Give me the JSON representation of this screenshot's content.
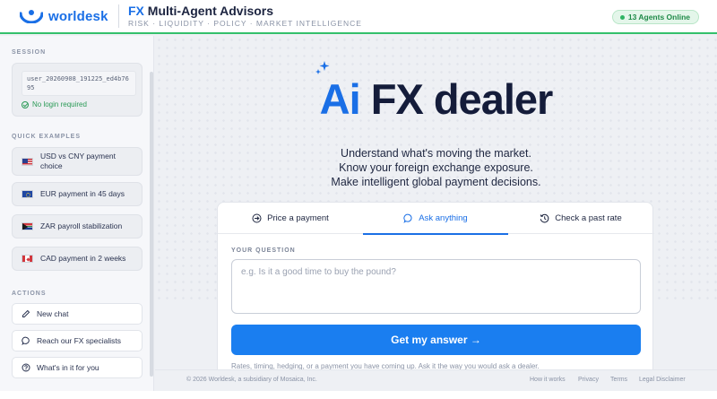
{
  "header": {
    "logo_text": "worldesk",
    "brand_fx": "FX",
    "brand_rest": " Multi-Agent Advisors",
    "subtitle": "RISK · LIQUIDITY · POLICY · MARKET INTELLIGENCE",
    "agents_badge": "13 Agents Online"
  },
  "sidebar": {
    "session_label": "SESSION",
    "session_id": "user_20260908_191225_ed4b7695",
    "no_login": "No login required",
    "examples_label": "QUICK EXAMPLES",
    "examples": [
      {
        "label": "USD vs CNY payment choice",
        "flag": "us-flag-icon"
      },
      {
        "label": "EUR payment in 45 days",
        "flag": "eu-flag-icon"
      },
      {
        "label": "ZAR payroll stabilization",
        "flag": "za-flag-icon"
      },
      {
        "label": "CAD payment in 2 weeks",
        "flag": "ca-flag-icon"
      }
    ],
    "actions_label": "ACTIONS",
    "actions": [
      {
        "label": "New chat",
        "icon": "edit-icon"
      },
      {
        "label": "Reach our FX specialists",
        "icon": "chat-bubble-icon"
      },
      {
        "label": "What's in it for you",
        "icon": "help-icon"
      }
    ]
  },
  "hero": {
    "title_ai": "Ai",
    "title_rest": " FX dealer",
    "line1": "Understand what's moving the market.",
    "line2": "Know your foreign exchange exposure.",
    "line3": "Make intelligent global payment decisions."
  },
  "tabs": [
    {
      "label": "Price a payment",
      "icon": "arrow-circle-icon",
      "active": false
    },
    {
      "label": "Ask anything",
      "icon": "chat-bubble-icon",
      "active": true
    },
    {
      "label": "Check a past rate",
      "icon": "history-icon",
      "active": false
    }
  ],
  "question": {
    "label": "YOUR QUESTION",
    "placeholder": "e.g. Is it a good time to buy the pound?",
    "value": "",
    "submit_label": "Get my answer →",
    "hint": "Rates, timing, hedging, or a payment you have coming up. Ask it the way you would ask a dealer."
  },
  "footer": {
    "copyright": "© 2026 Worldesk, a subsidiary of Mosaica, Inc.",
    "links": [
      "How it works",
      "Privacy",
      "Terms",
      "Legal Disclaimer"
    ]
  },
  "colors": {
    "accent": "#1a6fe6",
    "button": "#1a7ef0",
    "online_green": "#2fb463",
    "header_rule": "#34c06b"
  }
}
